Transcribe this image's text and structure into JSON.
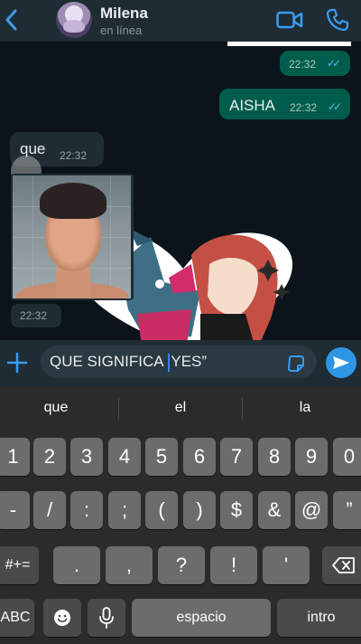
{
  "header": {
    "contact_name": "Milena",
    "status": "en línea",
    "icons": [
      "back-chevron-icon",
      "video-call-icon",
      "phone-call-icon"
    ],
    "accent": "#3b9cf2"
  },
  "messages": [
    {
      "direction": "out",
      "text": "",
      "time": "22:32",
      "ticks": "✓✓"
    },
    {
      "direction": "out",
      "text": "AISHA",
      "time": "22:32",
      "ticks": "✓✓"
    },
    {
      "direction": "in",
      "text": "que",
      "time": "22:32"
    },
    {
      "direction": "in",
      "type": "photo",
      "time": "22:32"
    },
    {
      "direction": "in",
      "type": "sticker"
    }
  ],
  "composer": {
    "text_before_caret": "QUE SIGNIFICA ",
    "text_after_caret": "YES”"
  },
  "keyboard": {
    "suggestions": [
      "que",
      "el",
      "la"
    ],
    "row1": [
      "1",
      "2",
      "3",
      "4",
      "5",
      "6",
      "7",
      "8",
      "9",
      "0"
    ],
    "row2": [
      "-",
      "/",
      ":",
      ";",
      "(",
      ")",
      "$",
      "&",
      "@",
      "”"
    ],
    "row3": [
      "#+=",
      ".",
      ",",
      "?",
      "!",
      "'"
    ],
    "row4": {
      "abc": "ABC",
      "space": "espacio",
      "return": "intro"
    }
  }
}
